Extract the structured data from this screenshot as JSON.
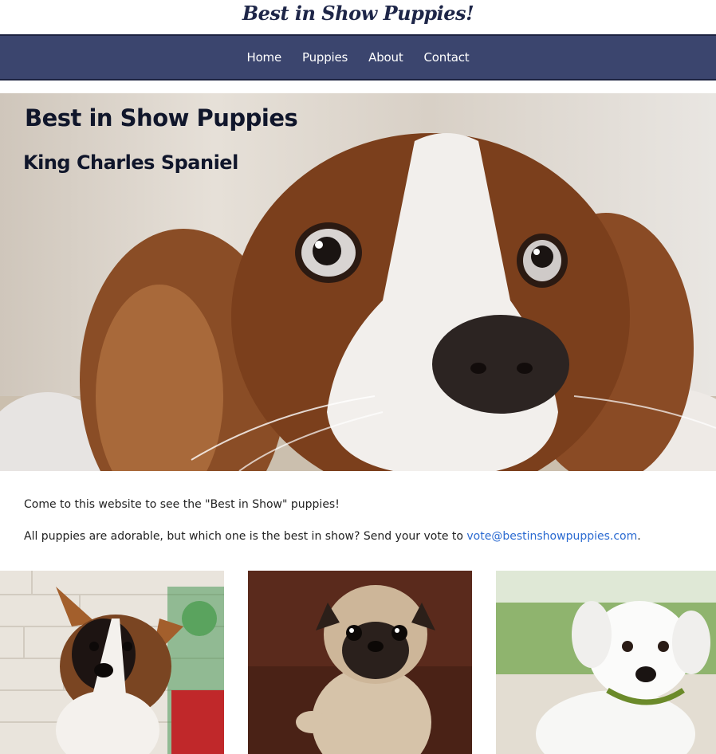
{
  "site": {
    "title": "Best in Show Puppies!"
  },
  "nav": {
    "items": [
      {
        "label": "Home"
      },
      {
        "label": "Puppies"
      },
      {
        "label": "About"
      },
      {
        "label": "Contact"
      }
    ]
  },
  "hero": {
    "title": "Best in Show Puppies",
    "subtitle": "King Charles Spaniel"
  },
  "intro": {
    "line1": "Come to this website to see the \"Best in Show\" puppies!",
    "line2_prefix": "All puppies are adorable, but which one is the best in show? Send your vote to ",
    "email": "vote@bestinshowpuppies.com",
    "line2_suffix": "."
  },
  "gallery": {
    "cards": [
      {
        "icon": "corgi-puppy-photo"
      },
      {
        "icon": "pug-puppy-photo"
      },
      {
        "icon": "white-puppy-photo"
      }
    ]
  }
}
